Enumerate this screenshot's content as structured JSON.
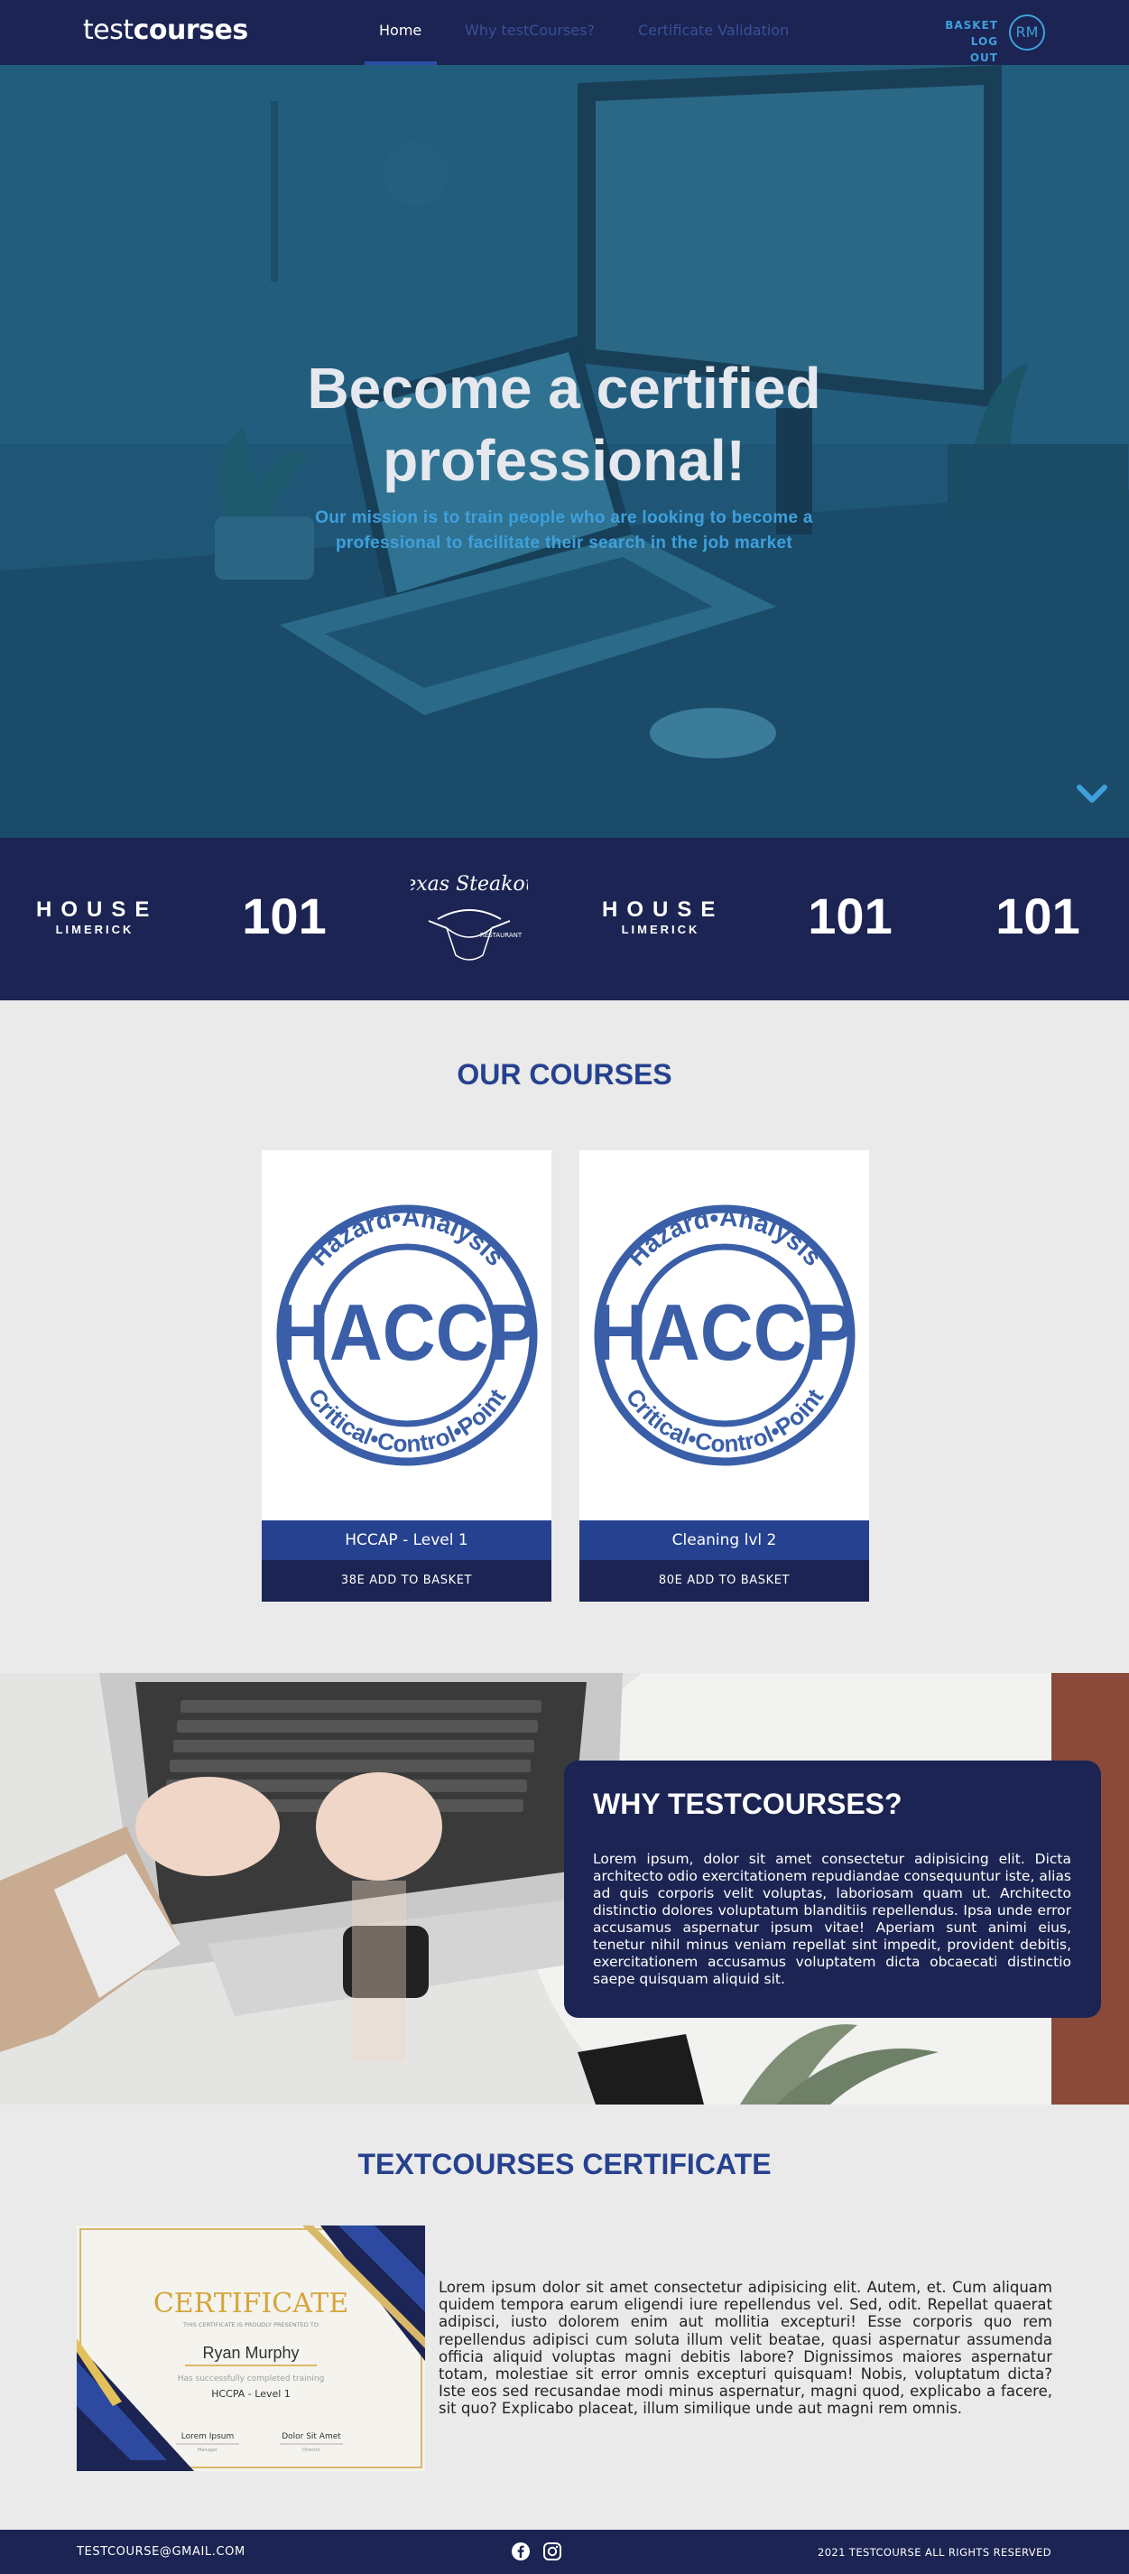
{
  "nav": {
    "logo_light": "test",
    "logo_bold": "courses",
    "links": [
      {
        "label": "Home",
        "active": true
      },
      {
        "label": "Why testCourses?",
        "active": false
      },
      {
        "label": "Certificate Validation",
        "active": false
      }
    ],
    "basket_label": "BASKET",
    "logout_label": "LOG OUT",
    "avatar_initials": "RM"
  },
  "hero": {
    "title_line1": "Become a certified",
    "title_line2": "professional!",
    "subtitle": "Our mission is to train people who are looking to become a professional to facilitate their search in the job market",
    "scroll_icon": "chevron-down-icon"
  },
  "partners": {
    "items": [
      {
        "type": "house",
        "big": "HOUSE",
        "small": "LIMERICK"
      },
      {
        "type": "number",
        "text": "101"
      },
      {
        "type": "logo",
        "text": "Texas Steakout",
        "small": "RESTAURANT"
      },
      {
        "type": "house",
        "big": "HOUSE",
        "small": "LIMERICK"
      },
      {
        "type": "number",
        "text": "101"
      },
      {
        "type": "number",
        "text": "101"
      }
    ]
  },
  "courses": {
    "title": "OUR COURSES",
    "badge_top": "Hazard•Analysis",
    "badge_main": "HACCP",
    "badge_bottom": "Critical•Control•Point",
    "items": [
      {
        "name": "HCCAP - Level 1",
        "button": "38E ADD TO BASKET"
      },
      {
        "name": "Cleaning lvl 2",
        "button": "80E ADD TO BASKET"
      }
    ]
  },
  "why": {
    "title": "WHY TESTCOURSES?",
    "text": "Lorem ipsum, dolor sit amet consectetur adipisicing elit. Dicta architecto odio exercitationem repudiandae consequuntur iste, alias ad quis corporis velit voluptas, laboriosam quam ut. Architecto distinctio dolores voluptatum blanditiis repellendus. Ipsa unde error accusamus aspernatur ipsum vitae! Aperiam sunt animi eius, tenetur nihil minus veniam repellat sint impedit, provident debitis, exercitationem accusamus voluptatem dicta obcaecati distinctio saepe quisquam aliquid sit."
  },
  "certificate": {
    "title": "TEXTCOURSES CERTIFICATE",
    "image": {
      "heading": "CERTIFICATE",
      "presented": "THIS CERTIFICATE IS PROUDLY PRESENTED TO",
      "recipient": "Ryan Murphy",
      "completed": "Has successfully completed training",
      "course": "HCCPA - Level 1",
      "sign1": "Lorem Ipsum",
      "sign1_role": "Manager",
      "sign2": "Dolor Sit Amet",
      "sign2_role": "Director"
    },
    "text": "Lorem ipsum dolor sit amet consectetur adipisicing elit. Autem, et. Cum aliquam quidem tempora earum eligendi iure repellendus vel. Sed, odit. Repellat quaerat adipisci, iusto dolorem enim aut mollitia excepturi! Esse corporis quo rem repellendus adipisci cum soluta illum velit beatae, quasi aspernatur assumenda officia aliquid voluptas magni debitis labore? Dignissimos maiores aspernatur totam, molestiae sit error omnis excepturi quisquam! Nobis, voluptatum dicta? Iste eos sed recusandae modi minus aspernatur, magni quod, explicabo a facere, sit quo? Explicabo placeat, illum similique unde aut magni rem omnis."
  },
  "footer": {
    "email": "TESTCOURSE@GMAIL.COM",
    "copyright": "2021 TESTCOURSE ALL RIGHTS RESERVED",
    "social": [
      "facebook-icon",
      "instagram-icon"
    ]
  },
  "colors": {
    "navy": "#1b2452",
    "royal_blue": "#26418f",
    "accent_blue": "#3fa0dc",
    "hero_overlay": "#1f5676",
    "page_bg": "#eaeaea"
  }
}
